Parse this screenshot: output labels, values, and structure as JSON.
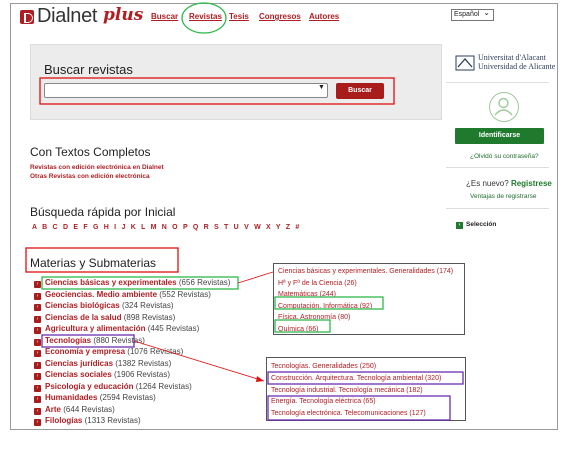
{
  "header": {
    "logo_text": "Dialnet",
    "logo_plus": "plus",
    "nav": [
      "Buscar",
      "Revistas",
      "Tesis",
      "Congresos",
      "Autores"
    ],
    "language": "Español"
  },
  "search": {
    "title": "Buscar revistas",
    "input_value": "",
    "button_label": "Buscar"
  },
  "textos": {
    "title": "Con Textos Completos",
    "links": [
      "Revistas con edición electrónica en Dialnet",
      "Otras Revistas con edición electrónica"
    ]
  },
  "busqueda": {
    "title": "Búsqueda rápida por Inicial",
    "letters": "A B C D E F G H I J K L M N O P Q R S T U V W X Y Z #"
  },
  "materias": {
    "title": "Materias y Submaterias",
    "items": [
      {
        "name": "Ciencias básicas y experimentales",
        "count": "(656 Revistas)"
      },
      {
        "name": "Geociencias. Medio ambiente",
        "count": "(552 Revistas)"
      },
      {
        "name": "Ciencias biológicas",
        "count": "(324 Revistas)"
      },
      {
        "name": "Ciencias de la salud",
        "count": "(898 Revistas)"
      },
      {
        "name": "Agricultura y alimentación",
        "count": "(445 Revistas)"
      },
      {
        "name": "Tecnologías",
        "count": "(880 Revistas)"
      },
      {
        "name": "Economía y empresa",
        "count": "(1076 Revistas)"
      },
      {
        "name": "Ciencias jurídicas",
        "count": "(1382 Revistas)"
      },
      {
        "name": "Ciencias sociales",
        "count": "(1906 Revistas)"
      },
      {
        "name": "Psicología y educación",
        "count": "(1264 Revistas)"
      },
      {
        "name": "Humanidades",
        "count": "(2594 Revistas)"
      },
      {
        "name": "Arte",
        "count": "(644 Revistas)"
      },
      {
        "name": "Filologías",
        "count": "(1313 Revistas)"
      }
    ]
  },
  "popup_ciencias": [
    "Ciencias básicas y experimentales. Generalidades (174)",
    "Hª y Fª de la Ciencia (26)",
    "Matemáticas (244)",
    "Computación. Informática (92)",
    "Física. Astronomía (80)",
    "Química (66)"
  ],
  "popup_tecnologias": [
    "Tecnologías. Generalidades (250)",
    "Construcción. Arquitectura. Tecnología ambiental (320)",
    "Tecnología industrial. Tecnología mecánica (182)",
    "Energía. Tecnología eléctrica (65)",
    "Tecnología electrónica. Telecomunicaciones (127)"
  ],
  "sidebar": {
    "university": [
      "Universitat d'Alacant",
      "Universidad de Alicante"
    ],
    "identify_label": "Identificarse",
    "forgot_label": "¿Olvidó su contraseña?",
    "nuevo_prefix": "¿Es nuevo?",
    "nuevo_link": "Registrese",
    "ventajas_label": "Ventajas de registrarse",
    "seleccion_label": "Selección"
  },
  "colors": {
    "brand": "#b01e23",
    "green": "#1f7a2e",
    "highlight_green": "#2eb84a",
    "highlight_purple": "#6a2fb0",
    "highlight_red": "#e01010"
  }
}
